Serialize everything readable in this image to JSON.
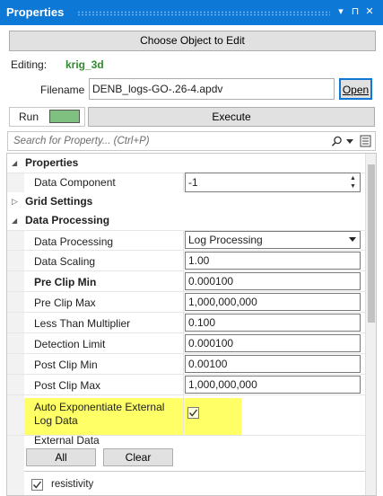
{
  "panel": {
    "title": "Properties",
    "controls": {
      "dropdown": "▾",
      "pin": "⊓",
      "close": "✕"
    }
  },
  "toolbar": {
    "choose_object_label": "Choose Object to Edit",
    "editing_label": "Editing:",
    "editing_value": "krig_3d",
    "filename_label": "Filename",
    "filename_value": "DENB_logs-GO-.26-4.apdv",
    "open_label": "Open",
    "run_label": "Run",
    "execute_label": "Execute"
  },
  "search": {
    "placeholder": "Search for Property... (Ctrl+P)"
  },
  "grid": {
    "categories": {
      "properties": "Properties",
      "grid_settings": "Grid Settings",
      "data_processing": "Data Processing"
    },
    "data_component": {
      "label": "Data Component",
      "value": "-1"
    },
    "rows": {
      "data_processing": {
        "label": "Data Processing",
        "value": "Log Processing"
      },
      "data_scaling": {
        "label": "Data Scaling",
        "value": "1.00"
      },
      "pre_clip_min": {
        "label": "Pre Clip Min",
        "value": "0.000100"
      },
      "pre_clip_max": {
        "label": "Pre Clip Max",
        "value": "1,000,000,000"
      },
      "less_than_multiplier": {
        "label": "Less Than Multiplier",
        "value": "0.100"
      },
      "detection_limit": {
        "label": "Detection Limit",
        "value": "0.000100"
      },
      "post_clip_min": {
        "label": "Post Clip Min",
        "value": "0.00100"
      },
      "post_clip_max": {
        "label": "Post Clip Max",
        "value": "1,000,000,000"
      }
    },
    "auto_exp": {
      "label_line1": "Auto Exponentiate External",
      "label_line2": "Log Data",
      "checked": true
    },
    "external_data": {
      "label": "External Data",
      "all_label": "All",
      "clear_label": "Clear",
      "items": [
        {
          "label": "resistivity",
          "checked": true
        }
      ]
    }
  },
  "colors": {
    "title_bar": "#0e78d7",
    "editing_value": "#2e8b2e",
    "run_swatch": "#7fbf7f",
    "highlight": "#ffff66"
  }
}
